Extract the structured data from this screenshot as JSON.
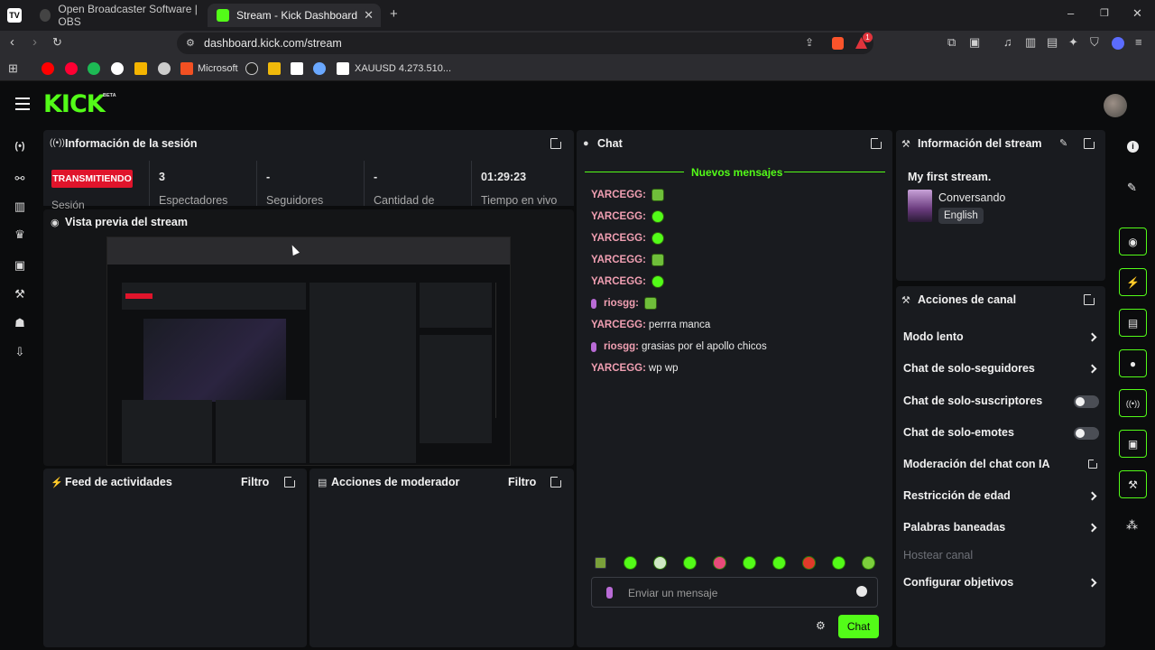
{
  "browser": {
    "tabs": [
      {
        "title": "Open Broadcaster Software | OBS"
      },
      {
        "title": "Stream - Kick Dashboard"
      }
    ],
    "url": "dashboard.kick.com/stream",
    "bookmarks": {
      "microsoft": "Microsoft",
      "xauusd": "XAUUSD 4.273.510..."
    },
    "brave_badge": "1"
  },
  "kick": {
    "logo": "KICK",
    "beta": "BETA"
  },
  "session": {
    "title": "Información de la sesión",
    "status": "TRANSMITIENDO",
    "status_sub": "Sesión",
    "viewers": "3",
    "viewers_label": "Espectadores",
    "followers": "-",
    "followers_label": "Seguidores",
    "count": "-",
    "count_label": "Cantidad de",
    "live_time": "01:29:23",
    "live_time_label": "Tiempo en vivo"
  },
  "preview": {
    "title": "Vista previa del stream"
  },
  "activity": {
    "title": "Feed de actividades",
    "filter": "Filtro"
  },
  "modactions": {
    "title": "Acciones de moderador",
    "filter": "Filtro"
  },
  "chat": {
    "title": "Chat",
    "new_messages": "Nuevos mensajes",
    "messages": [
      {
        "user": "YARCEGG:",
        "text": "",
        "emote": "sq",
        "mic": false
      },
      {
        "user": "YARCEGG:",
        "text": "",
        "emote": "g",
        "mic": false
      },
      {
        "user": "YARCEGG:",
        "text": "",
        "emote": "g",
        "mic": false
      },
      {
        "user": "YARCEGG:",
        "text": "",
        "emote": "sq",
        "mic": false
      },
      {
        "user": "YARCEGG:",
        "text": "",
        "emote": "g",
        "mic": false
      },
      {
        "user": "riosgg:",
        "text": "",
        "emote": "sq",
        "mic": true
      },
      {
        "user": "YARCEGG:",
        "text": "perrra manca",
        "emote": "",
        "mic": false
      },
      {
        "user": "riosgg:",
        "text": "grasias por el apollo chicos",
        "emote": "",
        "mic": true
      },
      {
        "user": "YARCEGG:",
        "text": "wp wp",
        "emote": "",
        "mic": false
      }
    ],
    "input_placeholder": "Enviar un mensaje",
    "send_label": "Chat"
  },
  "stream_info": {
    "title": "Información del stream",
    "stream_title": "My first stream.",
    "category": "Conversando",
    "language": "English"
  },
  "channel_actions": {
    "title": "Acciones de canal",
    "items": [
      {
        "label": "Modo lento",
        "control": "chevron"
      },
      {
        "label": "Chat de solo-seguidores",
        "control": "chevron"
      },
      {
        "label": "Chat de solo-suscriptores",
        "control": "toggle"
      },
      {
        "label": "Chat de solo-emotes",
        "control": "toggle"
      },
      {
        "label": "Moderación del chat con IA",
        "control": "external"
      },
      {
        "label": "Restricción de edad",
        "control": "chevron"
      },
      {
        "label": "Palabras baneadas",
        "control": "chevron"
      },
      {
        "label": "Hostear canal",
        "control": "none"
      },
      {
        "label": "Configurar objetivos",
        "control": "chevron"
      }
    ]
  },
  "colors": {
    "accent": "#53fc18",
    "live": "#e0142b",
    "username": "#f09fb2",
    "panel": "#191b1f"
  }
}
